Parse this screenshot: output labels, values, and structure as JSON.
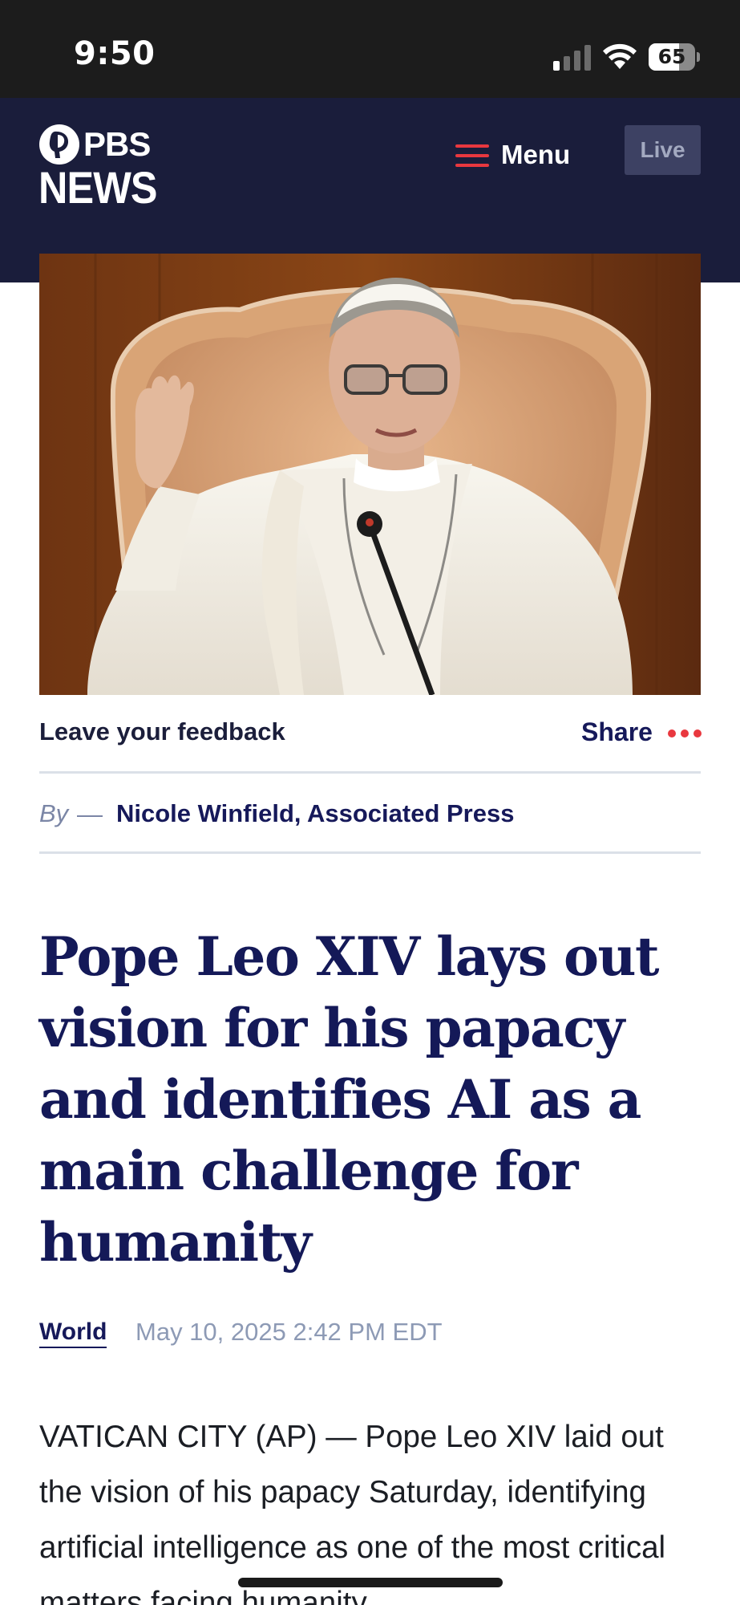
{
  "status_bar": {
    "time": "9:50",
    "battery_percent": "65",
    "battery_level": 0.65
  },
  "header": {
    "logo_top": "PBS",
    "logo_bottom": "NEWS",
    "menu_label": "Menu",
    "live_label": "Live",
    "background_color": "#1a1d3b",
    "accent_color": "#e9383f"
  },
  "hero_image": {
    "subject": "photo"
  },
  "actions": {
    "feedback_label": "Leave your feedback",
    "share_label": "Share",
    "more_icon": "more-dots-icon"
  },
  "byline": {
    "prefix": "By",
    "author": "Nicole Winfield, Associated Press"
  },
  "article": {
    "headline": "Pope Leo XIV lays out vision for his papacy and identifies AI as a main challenge for humanity",
    "section": "World",
    "date": "May 10, 2025 2:42 PM EDT",
    "body": "VATICAN CITY (AP) — Pope Leo XIV laid out the vision of his papacy Saturday, identifying artificial intelligence as one of the most critical matters facing humanity"
  }
}
